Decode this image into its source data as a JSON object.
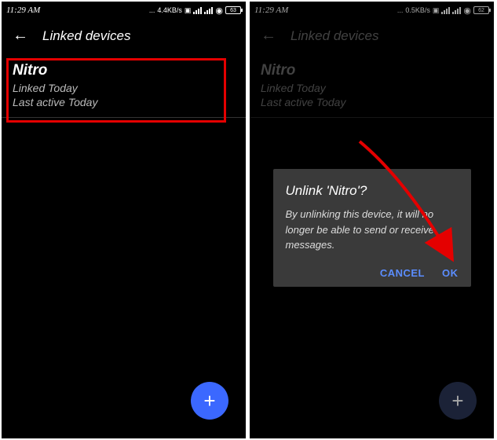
{
  "left": {
    "status": {
      "time": "11:29 AM",
      "speed": "4.4KB/s",
      "battery": "63"
    },
    "header": {
      "title": "Linked devices"
    },
    "device": {
      "name": "Nitro",
      "linked": "Linked Today",
      "active": "Last active Today"
    },
    "fab": "+"
  },
  "right": {
    "status": {
      "time": "11:29 AM",
      "speed": "0.5KB/s",
      "battery": "62"
    },
    "header": {
      "title": "Linked devices"
    },
    "device": {
      "name": "Nitro",
      "linked": "Linked Today",
      "active": "Last active Today"
    },
    "dialog": {
      "title": "Unlink 'Nitro'?",
      "body": "By unlinking this device, it will no longer be able to send or receive messages.",
      "cancel": "CANCEL",
      "ok": "OK"
    },
    "fab": "+"
  }
}
